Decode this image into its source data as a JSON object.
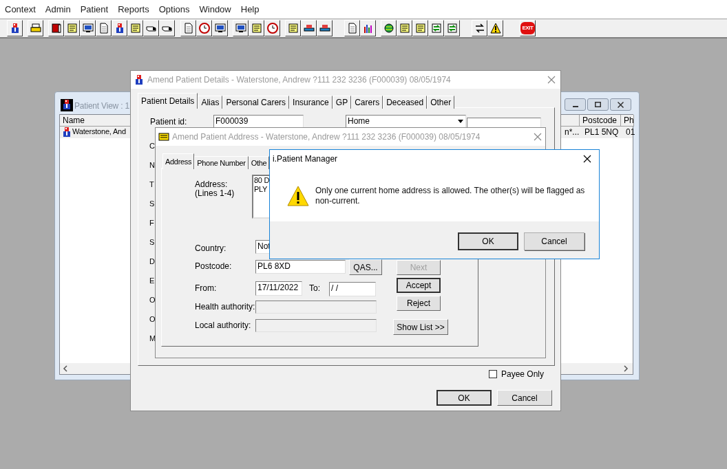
{
  "menu": [
    "Context",
    "Admin",
    "Patient",
    "Reports",
    "Options",
    "Window",
    "Help"
  ],
  "toolbar": {
    "exit_label": "EXIT"
  },
  "patient_view": {
    "title": "Patient View : 1",
    "columns": [
      "Name",
      "Postcode",
      "Ph"
    ],
    "rows": [
      {
        "name": "Waterstone, And",
        "column_2": "n*...",
        "postcode": "PL1 5NQ",
        "ph": "01",
        "selected": true
      }
    ]
  },
  "amend_details": {
    "title": "Amend Patient Details - Waterstone, Andrew ?111 232 3236 (F000039) 08/05/1974",
    "tabs": [
      {
        "label": "Patient Details",
        "selected": true
      },
      {
        "label": "Alias",
        "selected": false
      },
      {
        "label": "Personal Carers",
        "selected": false
      },
      {
        "label": "Insurance",
        "selected": false
      },
      {
        "label": "GP",
        "selected": false
      },
      {
        "label": "Carers",
        "selected": false
      },
      {
        "label": "Deceased",
        "selected": false
      },
      {
        "label": "Other",
        "selected": false
      }
    ],
    "patient_id_label": "Patient id:",
    "patient_id": "F000039",
    "address_type": "Home",
    "label_fragments": [
      "C",
      "N",
      "T",
      "S",
      "F",
      "S",
      "D",
      "E",
      "O",
      "O",
      "M"
    ],
    "payee_only": {
      "label": "Payee Only",
      "checked": false
    },
    "buttons": [
      {
        "label": "OK",
        "default": true
      },
      {
        "label": "Cancel",
        "default": false
      }
    ]
  },
  "amend_address": {
    "title": "Amend Patient  Address - Waterstone, Andrew ?111 232 3236 (F000039) 08/05/1974",
    "tabs": [
      {
        "label": "Address",
        "selected": true
      },
      {
        "label": "Phone Number",
        "selected": false
      },
      {
        "label": "Othe",
        "selected": false
      }
    ],
    "address_label": "Address:",
    "address_hint": "(Lines 1-4)",
    "address_lines": [
      "80 D",
      "PLY"
    ],
    "country_label": "Country:",
    "country": "Not",
    "postcode_label": "Postcode:",
    "postcode": "PL6 8XD",
    "qas_button": "QAS...",
    "from_label": "From:",
    "from": "17/11/2022",
    "to_label": "To:",
    "to": " /  /",
    "health_label": "Health authority:",
    "local_label": "Local authority:",
    "side_buttons": [
      {
        "label": "Next",
        "disabled": true,
        "default": false
      },
      {
        "label": "Accept",
        "disabled": false,
        "default": true
      },
      {
        "label": "Reject",
        "disabled": false,
        "default": false
      }
    ],
    "show_list_button": "Show List >>"
  },
  "message_box": {
    "title": "i.Patient Manager",
    "message": "Only one current home address is allowed. The other(s) will be flagged as non-current.",
    "buttons": [
      {
        "label": "OK",
        "default": true
      },
      {
        "label": "Cancel",
        "default": false
      }
    ]
  }
}
